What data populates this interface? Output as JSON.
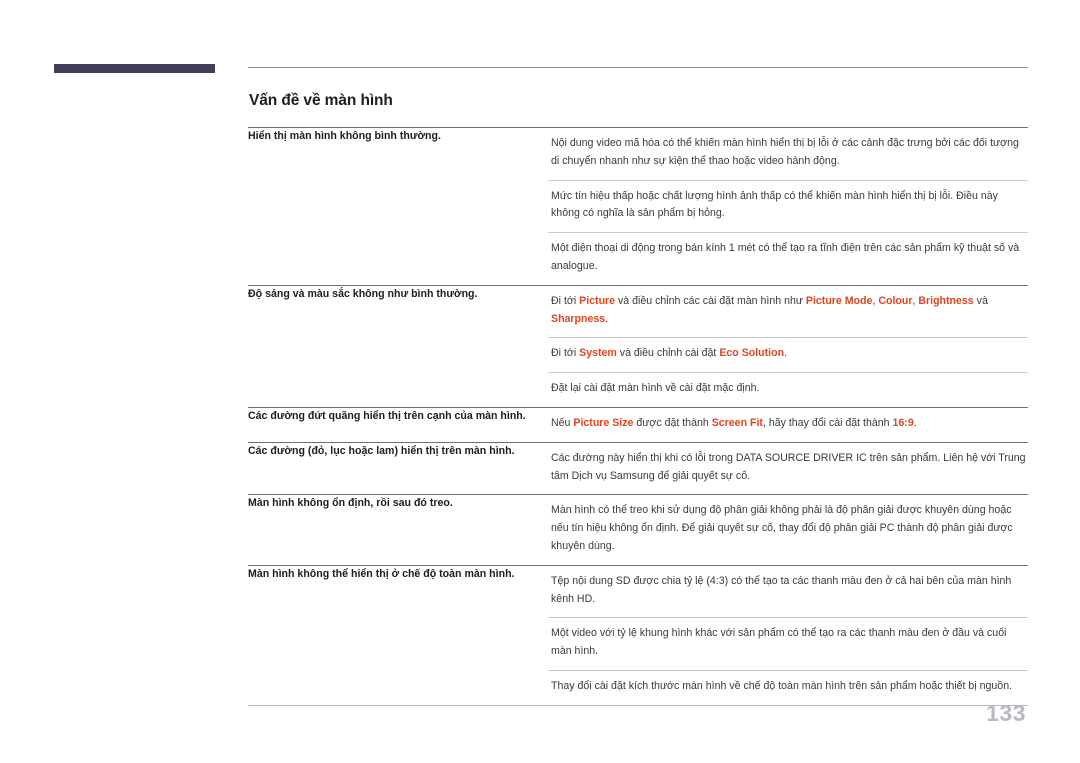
{
  "document": {
    "title": "Vấn đề về màn hình",
    "page_number": "133",
    "accent_color": "#e0451f",
    "corner_bar_color": "#453f56"
  },
  "faq": {
    "groups": [
      {
        "question": "Hiển thị màn hình không bình thường.",
        "answers": [
          [
            {
              "text": "Nội dung video mã hóa có thể khiến màn hình hiển thị bị lỗi ở các cảnh đặc trưng bởi các đối tượng di chuyển nhanh như sự kiện thể thao hoặc video hành động."
            }
          ],
          [
            {
              "text": "Mức tín hiệu thấp hoặc chất lượng hình ảnh thấp có thể khiến màn hình hiển thị bị lỗi. Điều này không có nghĩa là sản phẩm bị hỏng."
            }
          ],
          [
            {
              "text": "Một điện thoại di động trong bán kính 1 mét có thể tạo ra tĩnh điện trên các sản phẩm kỹ thuật số và analogue."
            }
          ]
        ]
      },
      {
        "question": "Độ sáng và màu sắc không như bình thường.",
        "answers": [
          [
            {
              "text": "Đi tới "
            },
            {
              "text": "Picture",
              "accent": true
            },
            {
              "text": " và điều chỉnh các cài đặt màn hình như "
            },
            {
              "text": "Picture Mode",
              "accent": true
            },
            {
              "text": ", "
            },
            {
              "text": "Colour",
              "accent": true
            },
            {
              "text": ", "
            },
            {
              "text": "Brightness",
              "accent": true
            },
            {
              "text": " và "
            },
            {
              "text": "Sharpness",
              "accent": true
            },
            {
              "text": "."
            }
          ],
          [
            {
              "text": "Đi tới "
            },
            {
              "text": "System",
              "accent": true
            },
            {
              "text": " và điều chỉnh cài đặt "
            },
            {
              "text": "Eco Solution",
              "accent": true
            },
            {
              "text": "."
            }
          ],
          [
            {
              "text": "Đặt lại cài đặt màn hình về cài đặt mặc định."
            }
          ]
        ]
      },
      {
        "question": "Các đường đứt quãng hiển thị trên cạnh của màn hình.",
        "answers": [
          [
            {
              "text": "Nếu "
            },
            {
              "text": "Picture Size",
              "accent": true
            },
            {
              "text": " được đặt thành "
            },
            {
              "text": "Screen Fit",
              "accent": true
            },
            {
              "text": ", hãy thay đổi cài đặt thành "
            },
            {
              "text": "16:9",
              "accent": true
            },
            {
              "text": "."
            }
          ]
        ]
      },
      {
        "question": "Các đường (đỏ, lục hoặc lam) hiển thị trên màn hình.",
        "answers": [
          [
            {
              "text": "Các đường này hiển thị khi có lỗi trong DATA SOURCE DRIVER IC trên sản phẩm. Liên hệ với Trung tâm Dịch vụ Samsung để giải quyết sự cố."
            }
          ]
        ]
      },
      {
        "question": "Màn hình không ổn định, rồi sau đó treo.",
        "answers": [
          [
            {
              "text": "Màn hình có thể treo khi sử dụng độ phân giải không phải là độ phân giải được khuyên dùng hoặc nếu tín hiệu không ổn định. Để giải quyết sự cố, thay đổi độ phân giải PC thành độ phân giải được khuyên dùng."
            }
          ]
        ]
      },
      {
        "question": "Màn hình không thể hiển thị ở chế độ toàn màn hình.",
        "answers": [
          [
            {
              "text": "Tệp nội dung SD được chia tỷ lệ (4:3) có thể tạo ta các thanh màu đen ở cả hai bên của màn hình kênh HD."
            }
          ],
          [
            {
              "text": "Một video với tỷ lệ khung hình khác với sản phẩm có thể tạo ra các thanh màu đen ở đầu và cuối màn hình."
            }
          ],
          [
            {
              "text": "Thay đổi cài đặt kích thước màn hình về chế độ toàn màn hình trên sản phẩm hoặc thiết bị nguồn."
            }
          ]
        ]
      }
    ]
  }
}
